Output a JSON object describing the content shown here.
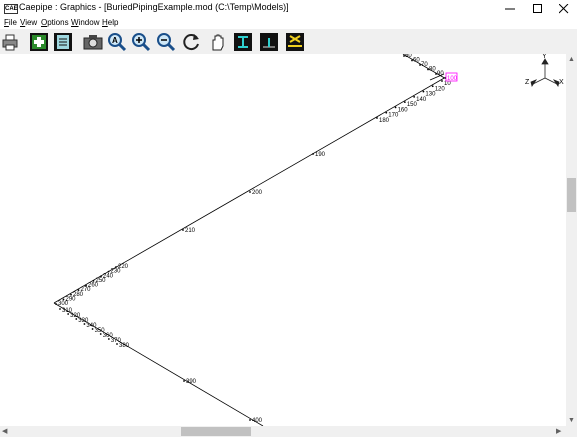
{
  "window": {
    "title": "Caepipe : Graphics -  [BuriedPipingExample.mod (C:\\Temp\\Models)]",
    "icon_text": "CAE"
  },
  "menu": [
    {
      "label": "File",
      "u": "F",
      "rest": "ile"
    },
    {
      "label": "View",
      "u": "V",
      "rest": "iew"
    },
    {
      "label": "Options",
      "u": "O",
      "rest": "ptions"
    },
    {
      "label": "Window",
      "u": "W",
      "rest": "indow"
    },
    {
      "label": "Help",
      "u": "H",
      "rest": "elp"
    }
  ],
  "toolbar": [
    "print-icon",
    "add-node-icon",
    "list-icon",
    "camera-icon",
    "zoom-fit-icon",
    "zoom-in-icon",
    "zoom-out-icon",
    "rotate-icon",
    "pan-hand-icon",
    "view-section-icon",
    "view-plan-icon",
    "view-elevation-icon"
  ],
  "axes": {
    "y": "Y",
    "x": "X",
    "z": "Z"
  },
  "nodes": {
    "top_run": [
      "50",
      "60",
      "70",
      "80",
      "90"
    ],
    "highlighted": "100",
    "right_run": [
      "10",
      "120",
      "130",
      "140",
      "150",
      "160",
      "170",
      "180",
      "190",
      "200",
      "210"
    ],
    "left_run": [
      "220",
      "230",
      "240",
      "250",
      "260",
      "270",
      "280",
      "290",
      "300"
    ],
    "lower_run": [
      "310",
      "320",
      "330",
      "340",
      "350",
      "360",
      "370",
      "380",
      "390",
      "400"
    ]
  },
  "colors": {
    "highlight": "#ff00ff",
    "pipe": "#000000"
  }
}
